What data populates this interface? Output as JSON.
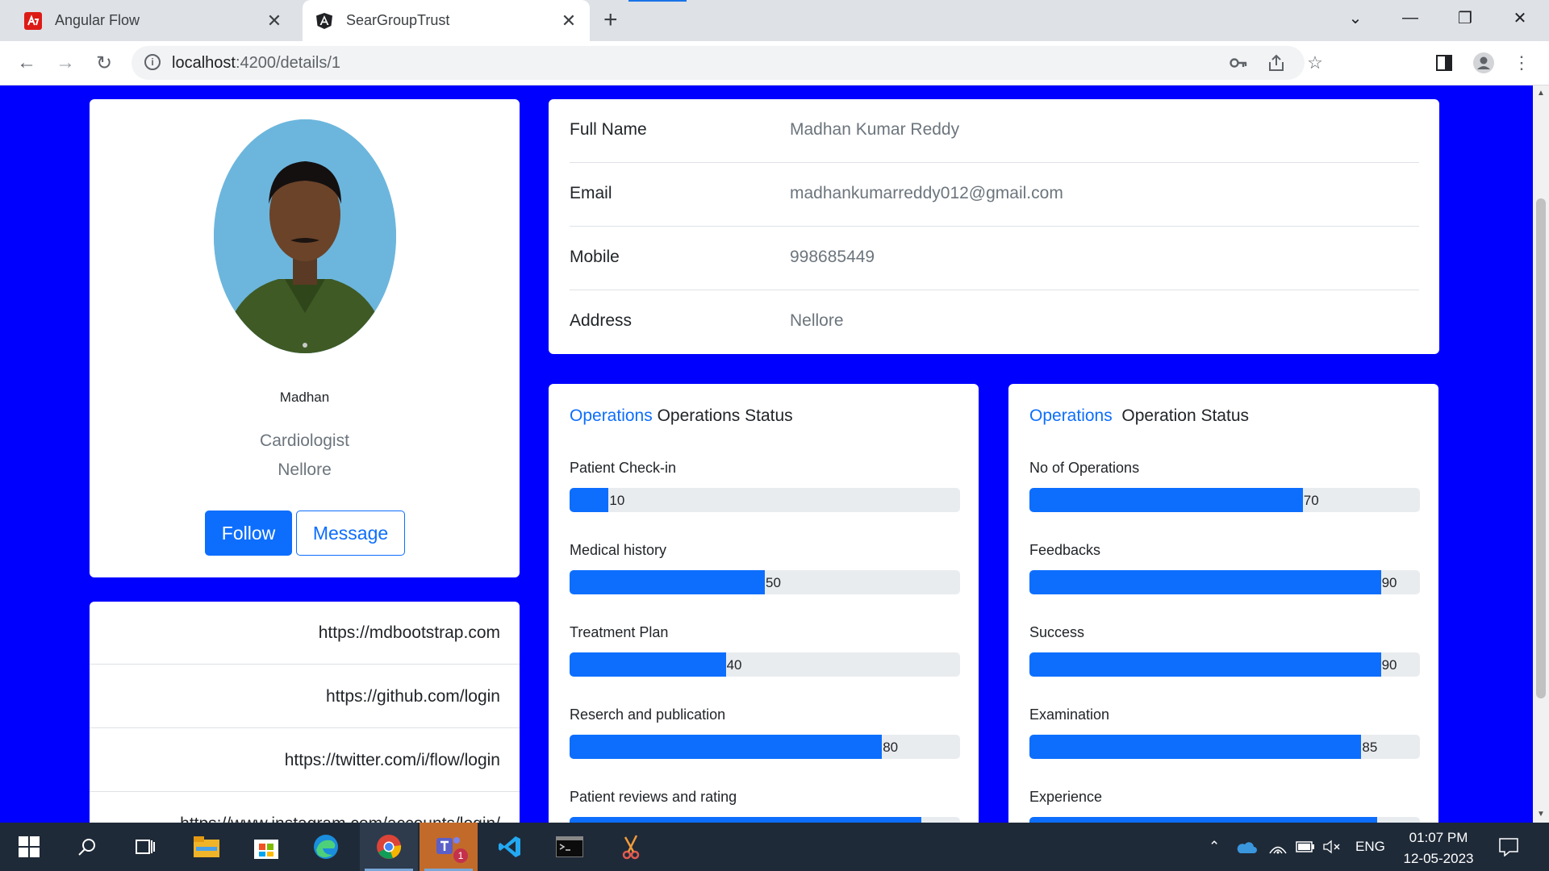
{
  "browser": {
    "tabs": [
      {
        "title": "Angular Flow",
        "icon": "angular-flow-icon",
        "active": false
      },
      {
        "title": "SearGroupTrust",
        "icon": "angular-icon",
        "active": true
      }
    ],
    "url_host": "localhost",
    "url_path": ":4200/details/1"
  },
  "profile": {
    "name": "Madhan",
    "role": "Cardiologist",
    "city": "Nellore",
    "follow_label": "Follow",
    "message_label": "Message"
  },
  "links": [
    "https://mdbootstrap.com",
    "https://github.com/login",
    "https://twitter.com/i/flow/login",
    "https://www.instagram.com/accounts/login/"
  ],
  "details": [
    {
      "label": "Full Name",
      "value": "Madhan Kumar Reddy"
    },
    {
      "label": "Email",
      "value": "madhankumarreddy012@gmail.com"
    },
    {
      "label": "Mobile",
      "value": "998685449"
    },
    {
      "label": "Address",
      "value": "Nellore"
    }
  ],
  "ops_left": {
    "accent": "Operations",
    "title": "Operations Status",
    "metrics": [
      {
        "label": "Patient Check-in",
        "value": 10
      },
      {
        "label": "Medical history",
        "value": 50
      },
      {
        "label": "Treatment Plan",
        "value": 40
      },
      {
        "label": "Reserch and publication",
        "value": 80
      },
      {
        "label": "Patient reviews and rating",
        "value": 90
      }
    ]
  },
  "ops_right": {
    "accent": "Operations",
    "title": "Operation Status",
    "metrics": [
      {
        "label": "No of Operations",
        "value": 70
      },
      {
        "label": "Feedbacks",
        "value": 90
      },
      {
        "label": "Success",
        "value": 90
      },
      {
        "label": "Examination",
        "value": 85
      },
      {
        "label": "Experience",
        "value": 89
      }
    ]
  },
  "taskbar": {
    "time": "01:07 PM",
    "date": "12-05-2023",
    "lang": "ENG",
    "badge": "1"
  },
  "colors": {
    "page_bg": "#0000ff",
    "primary": "#0d6efd"
  }
}
